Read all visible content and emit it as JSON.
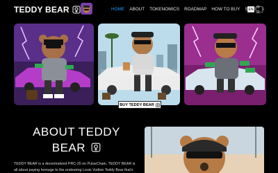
{
  "header": {
    "brand_title": "TEDDY BEAR",
    "nav": [
      "HOME",
      "ABOUT",
      "TOKENOMICS",
      "ROADMAP",
      "HOW TO BUY",
      "SOCIALS"
    ],
    "active_nav": "HOME",
    "languages": [
      "EN",
      "中文"
    ]
  },
  "gallery": {
    "card2_caption": "TEDDY BEAR",
    "buy_button": "BUY TEDDY BEAR"
  },
  "about": {
    "title": "ABOUT TEDDY BEAR",
    "text": "TEDDY BEAR is a decentralized PRC-20 on PulseChain. TEDDY BEAR is all about paying homage to the endearing Louis Vuitton Teddy Bear that's"
  },
  "colors": {
    "accent": "#1e9bff",
    "background": "#000000",
    "card1_bg": "#4a2a6a",
    "card2_bg": "#b9d9ea",
    "card3_bg": "#9a2a8a"
  },
  "icons": {
    "brand": "female-sign-in-circle-icon",
    "avatar": "teddy-avatar-icon"
  }
}
